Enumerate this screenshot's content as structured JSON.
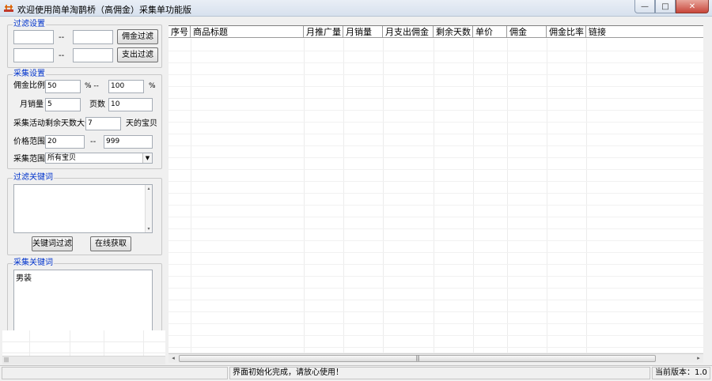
{
  "window": {
    "title": "欢迎使用简单淘鹊桥（高佣金）采集单功能版",
    "minimize_glyph": "—",
    "maximize_glyph": "□",
    "close_glyph": "✕"
  },
  "filter_settings": {
    "legend": "过滤设置",
    "separator": "--",
    "commission_filter_button": "佣金过滤",
    "expense_filter_button": "支出过滤",
    "commission_min": "",
    "commission_max": "",
    "expense_min": "",
    "expense_max": ""
  },
  "collect_settings": {
    "legend": "采集设置",
    "commission_ratio_label": "佣金比例",
    "commission_ratio_min": "50",
    "percent_separator": "% --",
    "commission_ratio_max": "100",
    "percent_suffix": "%",
    "monthly_sales_label": "月销量",
    "monthly_sales_value": "5",
    "pages_label": "页数",
    "pages_value": "10",
    "remaining_days_label": "采集活动剩余天数大于",
    "remaining_days_value": "7",
    "remaining_days_suffix": "天的宝贝",
    "price_range_label": "价格范围",
    "price_min": "20",
    "price_separator": "--",
    "price_max": "999",
    "scope_label": "采集范围",
    "scope_selected": "所有宝贝",
    "dropdown_arrow": "▼"
  },
  "filter_keywords": {
    "legend": "过滤关键词",
    "text": "",
    "keyword_filter_button": "关键词过滤",
    "online_fetch_button": "在线获取"
  },
  "collect_keywords": {
    "legend": "采集关键词",
    "text": "男装"
  },
  "grid": {
    "columns": [
      "序号",
      "商品标题",
      "月推广量",
      "月销量",
      "月支出佣金",
      "剩余天数",
      "单价",
      "佣金",
      "佣金比率",
      "链接"
    ]
  },
  "scrollbars": {
    "left_arrow": "◂",
    "right_arrow": "▸",
    "up_arrow": "▴",
    "down_arrow": "▾",
    "grip": "|||"
  },
  "status": {
    "message": "界面初始化完成，请放心使用！",
    "version": "当前版本：1.0"
  },
  "colors": {
    "legend_blue": "#0033cc",
    "grid_line": "#ececec",
    "close_red": "#c8463a"
  }
}
